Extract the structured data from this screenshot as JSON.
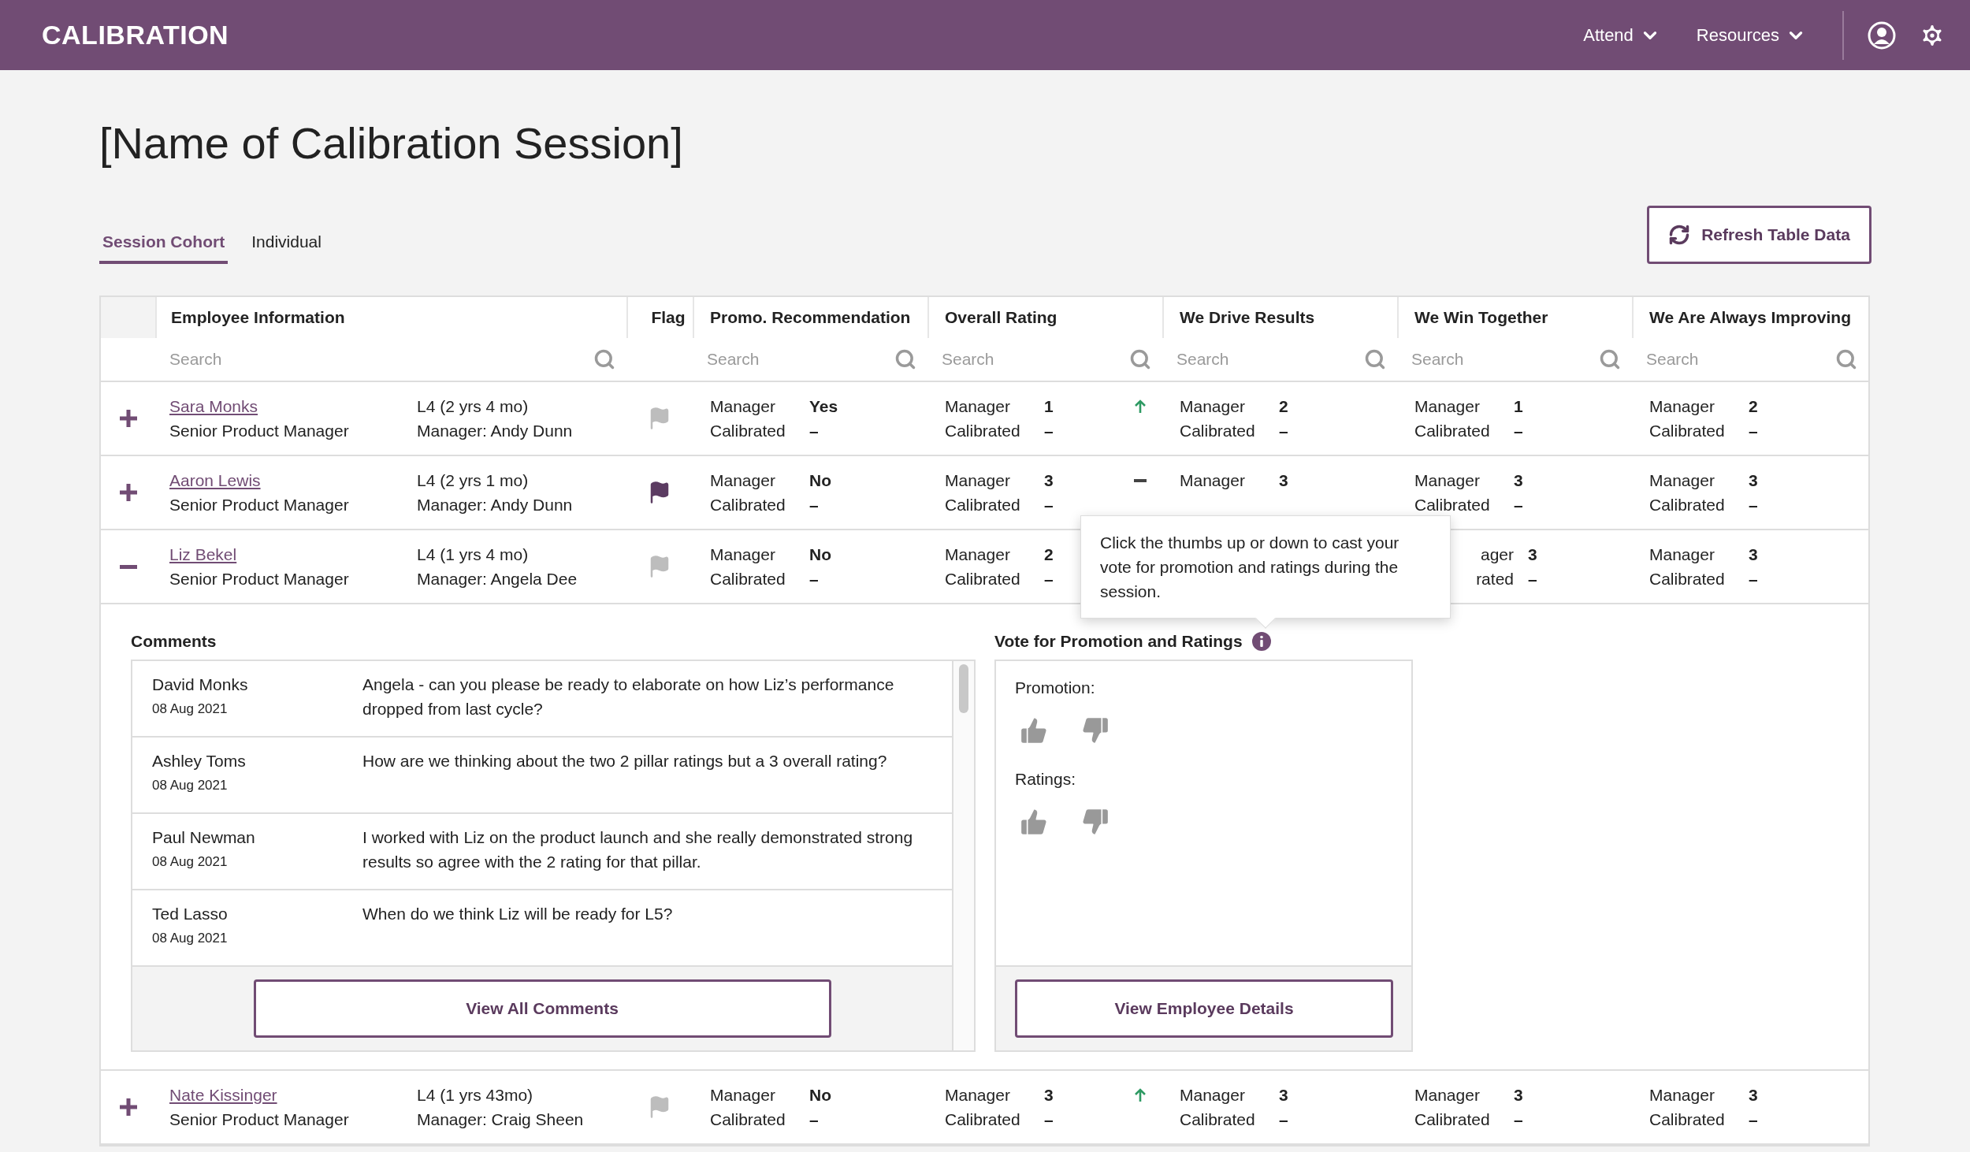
{
  "header": {
    "logo": "CALIBRATION",
    "nav": [
      {
        "label": "Attend"
      },
      {
        "label": "Resources"
      }
    ]
  },
  "title": "[Name of Calibration Session]",
  "tabs": [
    {
      "label": "Session Cohort",
      "selected": true
    },
    {
      "label": "Individual",
      "selected": false
    }
  ],
  "refresh_button": "Refresh Table Data",
  "table": {
    "columns": [
      {
        "label": "Employee Information",
        "placeholder": "Search"
      },
      {
        "label": "Flag"
      },
      {
        "label": "Promo. Recommendation",
        "placeholder": "Search"
      },
      {
        "label": "Overall Rating",
        "placeholder": "Search"
      },
      {
        "label": "We Drive Results",
        "placeholder": "Search"
      },
      {
        "label": "We Win Together",
        "placeholder": "Search"
      },
      {
        "label": "We Are Always Improving",
        "placeholder": "Search"
      }
    ],
    "rows": [
      {
        "expanded": false,
        "name": "Sara Monks",
        "role": "Senior Product Manager",
        "level": "L4 (2 yrs 4 mo)",
        "manager": "Manager: Andy Dunn",
        "flagged": false,
        "ratings": {
          "promo": {
            "top_label": "Manager",
            "value": "Yes",
            "bottom_label": "Calibrated",
            "calibrated": "–"
          },
          "overall": {
            "top_label": "Manager",
            "value": "1",
            "bottom_label": "Calibrated",
            "calibrated": "–",
            "rising": true
          },
          "drive": {
            "top_label": "Manager",
            "value": "2",
            "bottom_label": "Calibrated",
            "calibrated": "–"
          },
          "win": {
            "top_label": "Manager",
            "value": "1",
            "bottom_label": "Calibrated",
            "calibrated": "–"
          },
          "improve": {
            "top_label": "Manager",
            "value": "2",
            "bottom_label": "Calibrated",
            "calibrated": "–"
          }
        }
      },
      {
        "expanded": false,
        "name": "Aaron Lewis",
        "role": "Senior Product Manager",
        "level": "L4 (2 yrs 1 mo)",
        "manager": "Manager: Andy Dunn",
        "flagged": true,
        "ratings": {
          "promo": {
            "top_label": "Manager",
            "value": "No",
            "bottom_label": "Calibrated",
            "calibrated": "–"
          },
          "overall": {
            "top_label": "Manager",
            "value": "3",
            "bottom_label": "Calibrated",
            "calibrated": "–",
            "rising": false
          },
          "drive": {
            "top_label": "Manager",
            "value": "3"
          },
          "win": {
            "top_label": "Manager",
            "value": "3",
            "bottom_label": "Calibrated",
            "calibrated": "–"
          },
          "improve": {
            "top_label": "Manager",
            "value": "3",
            "bottom_label": "Calibrated",
            "calibrated": "–"
          }
        }
      },
      {
        "expanded": true,
        "name": "Liz Bekel",
        "role": "Senior Product Manager",
        "level": "L4 (1 yrs 4 mo)",
        "manager": "Manager: Angela Dee",
        "flagged": false,
        "ratings": {
          "promo": {
            "top_label": "Manager",
            "value": "No",
            "bottom_label": "Calibrated",
            "calibrated": "–"
          },
          "overall": {
            "top_label": "Manager",
            "value": "2",
            "bottom_label": "Calibrated",
            "calibrated": "–"
          },
          "win": {
            "top_label": "ager",
            "value": "3",
            "bottom_label": "rated",
            "calibrated": "–",
            "partial": true
          },
          "improve": {
            "top_label": "Manager",
            "value": "3",
            "bottom_label": "Calibrated",
            "calibrated": "–"
          }
        },
        "details": {
          "comments_title": "Comments",
          "comments": [
            {
              "author": "David Monks",
              "date": "08 Aug 2021",
              "text": "Angela - can you please be ready to elaborate on how Liz’s performance dropped from last cycle?"
            },
            {
              "author": "Ashley Toms",
              "date": "08 Aug 2021",
              "text": "How are we thinking about the two 2 pillar ratings but a 3 overall rating?"
            },
            {
              "author": "Paul Newman",
              "date": "08 Aug 2021",
              "text": "I worked with Liz on the product launch and she really demonstrated strong results so agree with the 2 rating for that pillar."
            },
            {
              "author": "Ted Lasso",
              "date": "08 Aug 2021",
              "text": "When do we think Liz will be ready for L5?"
            }
          ],
          "comments_button": "View All Comments",
          "vote_title": "Vote for Promotion and Ratings",
          "vote_groups": [
            {
              "label": "Promotion:"
            },
            {
              "label": "Ratings:"
            }
          ],
          "details_button": "View Employee Details"
        }
      },
      {
        "expanded": false,
        "name": "Nate Kissinger",
        "role": "Senior Product Manager",
        "level": "L4 (1 yrs 43mo)",
        "manager": "Manager: Craig Sheen",
        "flagged": false,
        "ratings": {
          "promo": {
            "top_label": "Manager",
            "value": "No",
            "bottom_label": "Calibrated",
            "calibrated": "–"
          },
          "overall": {
            "top_label": "Manager",
            "value": "3",
            "bottom_label": "Calibrated",
            "calibrated": "–",
            "rising": true
          },
          "drive": {
            "top_label": "Manager",
            "value": "3",
            "bottom_label": "Calibrated",
            "calibrated": "–"
          },
          "win": {
            "top_label": "Manager",
            "value": "3",
            "bottom_label": "Calibrated",
            "calibrated": "–"
          },
          "improve": {
            "top_label": "Manager",
            "value": "3",
            "bottom_label": "Calibrated",
            "calibrated": "–"
          }
        }
      }
    ]
  },
  "tooltip": "Click the thumbs up or down to cast your vote for promotion and ratings during the session."
}
